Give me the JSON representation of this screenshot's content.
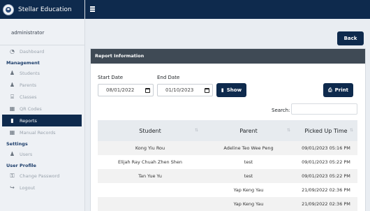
{
  "brand": {
    "name": "Stellar Education"
  },
  "user": {
    "name": "administrator"
  },
  "sidebar": {
    "items": [
      {
        "type": "item",
        "label": "Dashboard",
        "icon": "dashboard-icon"
      },
      {
        "type": "section",
        "label": "Management"
      },
      {
        "type": "item",
        "label": "Students",
        "icon": "student-icon"
      },
      {
        "type": "item",
        "label": "Parents",
        "icon": "parents-icon"
      },
      {
        "type": "item",
        "label": "Classes",
        "icon": "classes-icon"
      },
      {
        "type": "item",
        "label": "QR Codes",
        "icon": "qr-code-icon"
      },
      {
        "type": "item",
        "label": "Reports",
        "icon": "reports-icon",
        "active": true
      },
      {
        "type": "item",
        "label": "Manual Records",
        "icon": "records-icon"
      },
      {
        "type": "section",
        "label": "Settings"
      },
      {
        "type": "item",
        "label": "Users",
        "icon": "users-icon"
      },
      {
        "type": "section",
        "label": "User Profile"
      },
      {
        "type": "item",
        "label": "Change Password",
        "icon": "key-icon"
      },
      {
        "type": "item",
        "label": "Logout",
        "icon": "logout-icon"
      }
    ]
  },
  "toolbar": {
    "back_label": "Back"
  },
  "report": {
    "header": "Report Information",
    "start_label": "Start Date",
    "end_label": "End Date",
    "start_value": "08/01/2022",
    "end_value": "01/10/2023",
    "show_label": "Show",
    "print_label": "Print",
    "search_label": "Search:",
    "search_value": ""
  },
  "table": {
    "columns": [
      "Student",
      "Parent",
      "Picked Up Time"
    ],
    "rows": [
      [
        "Kong Yiu Rou",
        "Adeline Teo Wee Peng",
        "09/01/2023 05:16 PM"
      ],
      [
        "Elijah Ray Chuah Zhen Shen",
        "test",
        "09/01/2023 05:22 PM"
      ],
      [
        "Tan Yue Yu",
        "test",
        "09/01/2023 05:22 PM"
      ],
      [
        "",
        "Yap Keng Yau",
        "21/09/2022 02:36 PM"
      ],
      [
        "",
        "Yap Keng Yau",
        "21/09/2022 02:36 PM"
      ]
    ]
  },
  "colors": {
    "navy": "#0e2a4d",
    "card_header": "#3f4a55"
  }
}
